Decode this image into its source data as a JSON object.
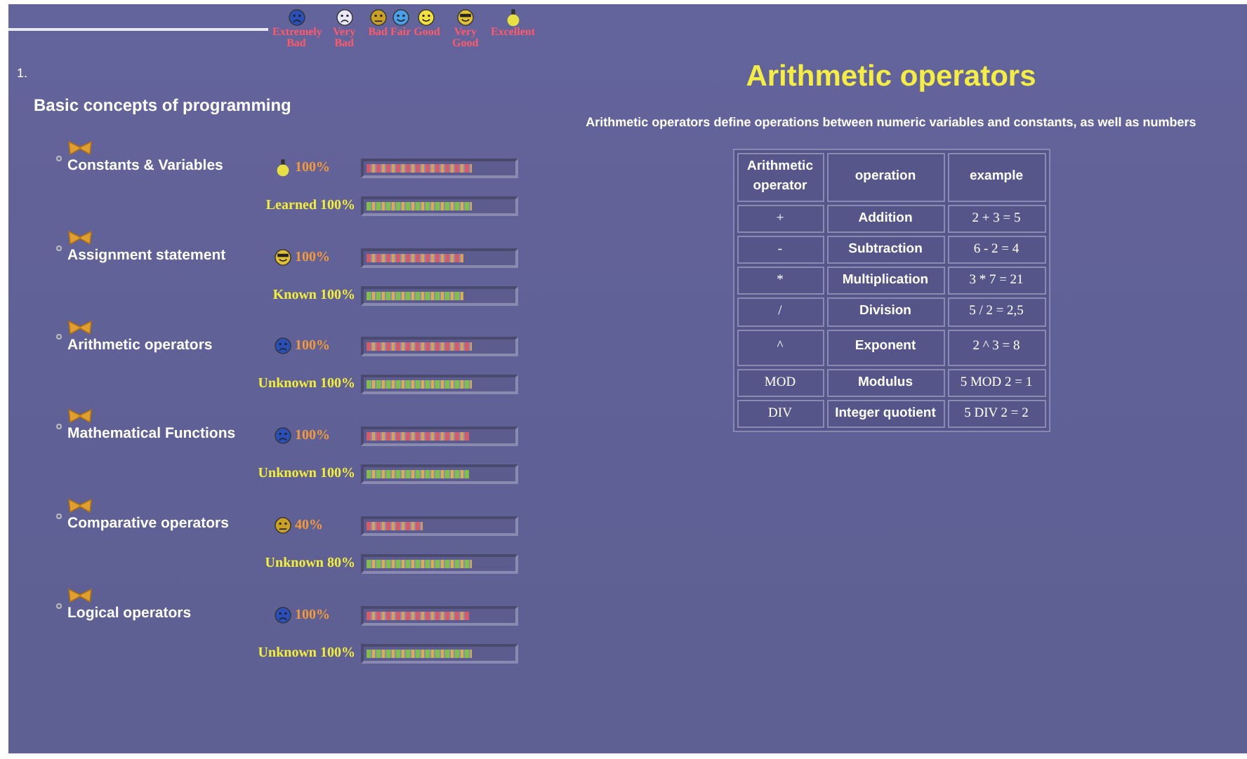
{
  "legend": [
    {
      "label": "Extremely Bad",
      "kind": "extremely-bad"
    },
    {
      "label": "Very Bad",
      "kind": "very-bad"
    },
    {
      "label": "Bad",
      "kind": "bad"
    },
    {
      "label": "Fair",
      "kind": "fair"
    },
    {
      "label": "Good",
      "kind": "good"
    },
    {
      "label": "Very Good",
      "kind": "very-good"
    },
    {
      "label": "Excellent",
      "kind": "excellent"
    }
  ],
  "section": {
    "number": "1.",
    "title": "Basic concepts of programming"
  },
  "topics": [
    {
      "title": "Constants & Variables",
      "kind": "excellent",
      "rating": {
        "text": "100%",
        "level": 0.72
      },
      "status": {
        "text": "Learned 100%",
        "level": 0.72
      }
    },
    {
      "title": "Assignment statement",
      "kind": "very-good",
      "rating": {
        "text": "100%",
        "level": 0.66
      },
      "status": {
        "text": "Known 100%",
        "level": 0.66
      }
    },
    {
      "title": "Arithmetic operators",
      "kind": "extremely-bad",
      "rating": {
        "text": "100%",
        "level": 0.72
      },
      "status": {
        "text": "Unknown 100%",
        "level": 0.72
      }
    },
    {
      "title": "Mathematical Functions",
      "kind": "extremely-bad",
      "rating": {
        "text": "100%",
        "level": 0.7
      },
      "status": {
        "text": "Unknown 100%",
        "level": 0.7
      }
    },
    {
      "title": "Comparative operators",
      "kind": "bad",
      "rating": {
        "text": "40%",
        "level": 0.38
      },
      "status": {
        "text": "Unknown 80%",
        "level": 0.72
      }
    },
    {
      "title": "Logical operators",
      "kind": "extremely-bad",
      "rating": {
        "text": "100%",
        "level": 0.7
      },
      "status": {
        "text": "Unknown 100%",
        "level": 0.72
      }
    }
  ],
  "slide": {
    "title": "Arithmetic operators",
    "subtitle": "Arithmetic operators define operations between numeric variables and constants, as well as numbers",
    "table": {
      "columns": [
        "Arithmetic operator",
        "operation",
        "example"
      ],
      "rows": [
        [
          "+",
          "Addition",
          "2 + 3 = 5"
        ],
        [
          "-",
          "Subtraction",
          "6 - 2 = 4"
        ],
        [
          "*",
          "Multiplication",
          "3 * 7 = 21"
        ],
        [
          "/",
          "Division",
          "5 / 2 = 2,5"
        ],
        [
          "^",
          "Exponent",
          "2 ^ 3 = 8"
        ],
        [
          "MOD",
          "Modulus",
          "5 MOD 2 = 1"
        ],
        [
          "DIV",
          "Integer quotient",
          "5 DIV 2 = 2"
        ]
      ]
    }
  }
}
